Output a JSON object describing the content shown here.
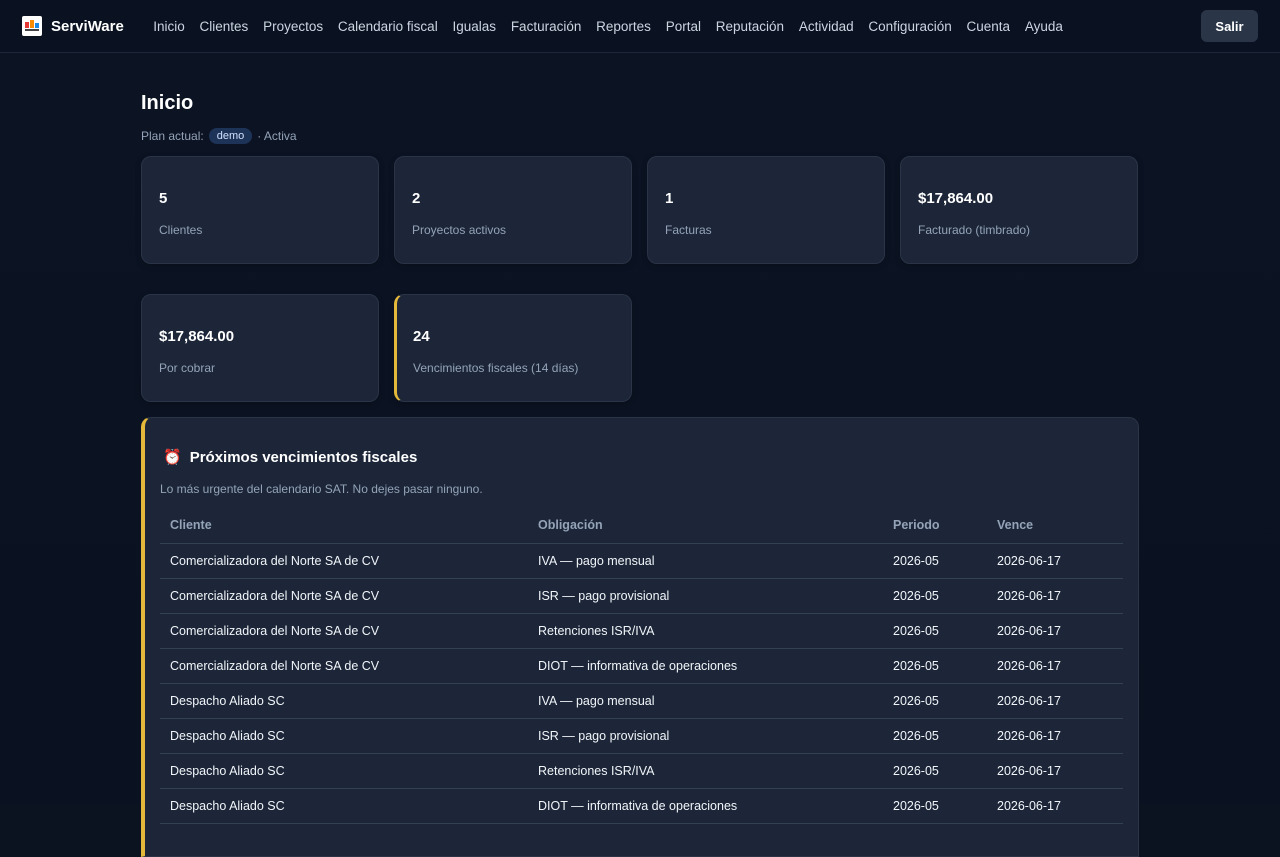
{
  "app": {
    "brand": "ServiWare",
    "logout_label": "Salir"
  },
  "nav": [
    "Inicio",
    "Clientes",
    "Proyectos",
    "Calendario fiscal",
    "Igualas",
    "Facturación",
    "Reportes",
    "Portal",
    "Reputación",
    "Actividad",
    "Configuración",
    "Cuenta",
    "Ayuda"
  ],
  "page": {
    "title": "Inicio",
    "plan_label": "Plan actual:",
    "plan_badge": "demo",
    "plan_status": "· Activa"
  },
  "stats_row1": [
    {
      "value": "5",
      "label": "Clientes"
    },
    {
      "value": "2",
      "label": "Proyectos activos"
    },
    {
      "value": "1",
      "label": "Facturas"
    },
    {
      "value": "$17,864.00",
      "label": "Facturado (timbrado)"
    }
  ],
  "stats_row2": [
    {
      "value": "$17,864.00",
      "label": "Por cobrar"
    },
    {
      "value": "24",
      "label": "Vencimientos fiscales (14 días)"
    }
  ],
  "dues": {
    "title": "Próximos vencimientos fiscales",
    "subtitle": "Lo más urgente del calendario SAT. No dejes pasar ninguno.",
    "columns": [
      "Cliente",
      "Obligación",
      "Periodo",
      "Vence"
    ],
    "rows": [
      [
        "Comercializadora del Norte SA de CV",
        "IVA — pago mensual",
        "2026-05",
        "2026-06-17"
      ],
      [
        "Comercializadora del Norte SA de CV",
        "ISR — pago provisional",
        "2026-05",
        "2026-06-17"
      ],
      [
        "Comercializadora del Norte SA de CV",
        "Retenciones ISR/IVA",
        "2026-05",
        "2026-06-17"
      ],
      [
        "Comercializadora del Norte SA de CV",
        "DIOT — informativa de operaciones",
        "2026-05",
        "2026-06-17"
      ],
      [
        "Despacho Aliado SC",
        "IVA — pago mensual",
        "2026-05",
        "2026-06-17"
      ],
      [
        "Despacho Aliado SC",
        "ISR — pago provisional",
        "2026-05",
        "2026-06-17"
      ],
      [
        "Despacho Aliado SC",
        "Retenciones ISR/IVA",
        "2026-05",
        "2026-06-17"
      ],
      [
        "Despacho Aliado SC",
        "DIOT — informativa de operaciones",
        "2026-05",
        "2026-06-17"
      ]
    ]
  },
  "colors": {
    "background": "#0b1220",
    "card": "#1c2638",
    "accent_alert": "#e4b83a",
    "badge": "#1e3358"
  }
}
